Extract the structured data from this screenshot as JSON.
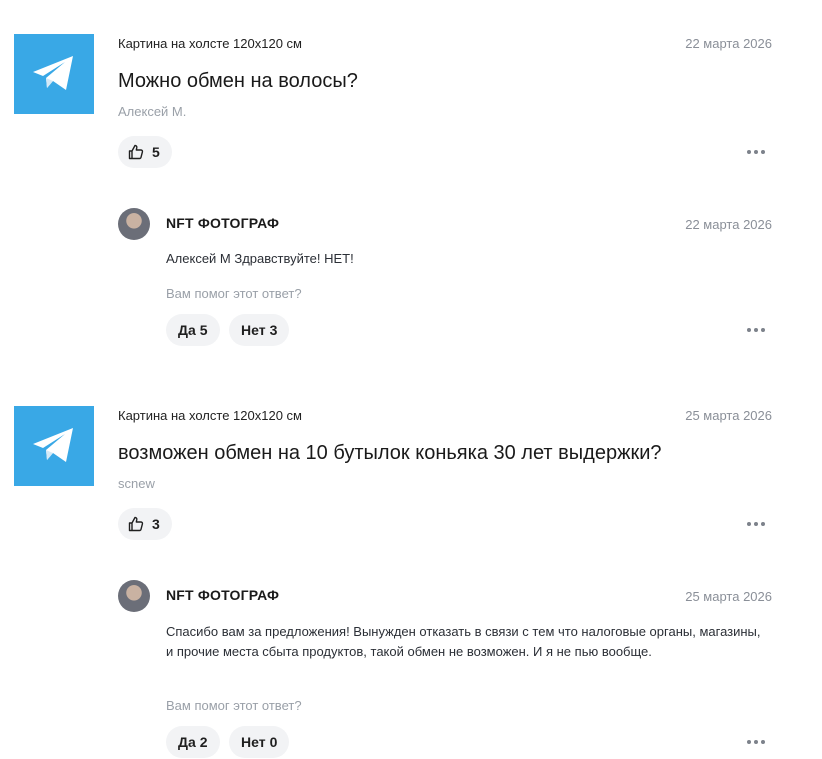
{
  "colors": {
    "telegram_blue": "#39a8e6",
    "muted_text": "#8a8f98",
    "pill_bg": "#f2f3f5"
  },
  "questions": [
    {
      "product": "Картина на холсте 120x120 см",
      "date": "22 марта 2026",
      "text": "Можно обмен на волосы?",
      "author": "Алексей М.",
      "likes": "5",
      "thumbnail_icon": "telegram-icon",
      "answer": {
        "seller": "NFT ФОТОГРАФ",
        "date": "22 марта 2026",
        "text": "Алексей М Здравствуйте! НЕТ!",
        "helpful_prompt": "Вам помог этот ответ?",
        "yes_label": "Да",
        "yes_count": "5",
        "no_label": "Нет",
        "no_count": "3"
      }
    },
    {
      "product": "Картина на холсте 120x120 см",
      "date": "25 марта 2026",
      "text": "возможен обмен на 10 бутылок коньяка 30 лет выдержки?",
      "author": "scnew",
      "likes": "3",
      "thumbnail_icon": "telegram-icon",
      "answer": {
        "seller": "NFT ФОТОГРАФ",
        "date": "25 марта 2026",
        "text": "Спасибо вам за предложения! Вынужден отказать в связи с тем что налоговые органы, магазины, и прочие места сбыта продуктов, такой обмен не возможен. И я не пью вообще.",
        "helpful_prompt": "Вам помог этот ответ?",
        "yes_label": "Да",
        "yes_count": "2",
        "no_label": "Нет",
        "no_count": "0"
      }
    }
  ]
}
